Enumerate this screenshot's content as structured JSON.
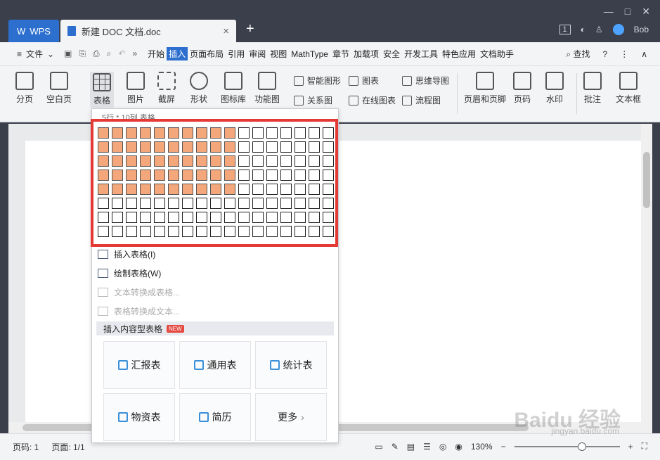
{
  "titlebar": {
    "app_tab": "WPS",
    "doc_tab": "新建 DOC 文档.doc",
    "close_glyph": "×",
    "add_glyph": "+",
    "badge": "1",
    "user": "Bob",
    "window_controls": [
      "—",
      "□",
      "✕"
    ]
  },
  "menubar": {
    "file_label": "文件",
    "tabs": [
      "开始",
      "插入",
      "页面布局",
      "引用",
      "审阅",
      "视图",
      "MathType",
      "章节",
      "加载项",
      "安全",
      "开发工具",
      "特色应用",
      "文档助手"
    ],
    "active_tab": "插入",
    "search_label": "查找",
    "help_glyph": "?",
    "more_glyph": "⋮",
    "collapse_glyph": "∧"
  },
  "ribbon": {
    "big_buttons": [
      "分页",
      "空白页",
      "表格",
      "图片",
      "截屏",
      "形状",
      "图标库",
      "功能图"
    ],
    "small_buttons": [
      "智能图形",
      "图表",
      "思维导图",
      "关系图",
      "在线图表",
      "流程图"
    ],
    "right_buttons": [
      "页眉和页脚",
      "页码",
      "水印",
      "批注",
      "文本框"
    ]
  },
  "dropdown": {
    "caption": "5行 * 10列 表格",
    "grid": {
      "rows": 8,
      "cols": 17,
      "selected_rows": 5,
      "selected_cols": 10
    },
    "menu_items": [
      {
        "label": "插入表格(I)",
        "enabled": true
      },
      {
        "label": "绘制表格(W)",
        "enabled": true
      },
      {
        "label": "文本转换成表格...",
        "enabled": false
      },
      {
        "label": "表格转换成文本...",
        "enabled": false
      }
    ],
    "section_title": "插入内容型表格",
    "new_badge": "NEW",
    "tiles": [
      "汇报表",
      "通用表",
      "统计表",
      "物资表",
      "简历",
      "更多"
    ],
    "more_chevron": "›",
    "highlight_color": "#e53935",
    "cell_selected_color": "#f4a77a"
  },
  "statusbar": {
    "page_num": "页码: 1",
    "page_count": "页面: 1/1",
    "zoom": "130%",
    "zoom_out": "−",
    "zoom_in": "+"
  },
  "watermark": {
    "brand": "Baidu 经验",
    "url": "jingyan.baidu.com"
  }
}
